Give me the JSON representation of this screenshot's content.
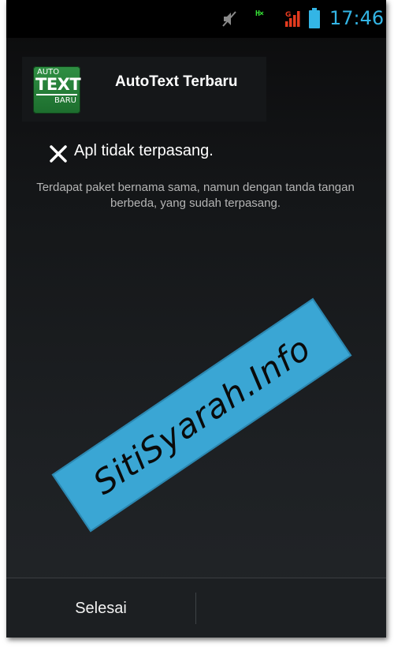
{
  "status_bar": {
    "time": "17:46",
    "network_label": "H×",
    "signal_label": "G",
    "colors": {
      "clock": "#33b5e5",
      "network": "#35e035",
      "signal": "#e33b1f"
    }
  },
  "app": {
    "name": "AutoText Terbaru",
    "icon_text": {
      "line1": "AUTO",
      "line2": "TEXT",
      "line3": "BARU"
    },
    "icon_color": "#2f8f43"
  },
  "message": {
    "title": "Apl tidak terpasang.",
    "description": "Terdapat paket bernama sama, namun dengan tanda tangan berbeda, yang sudah terpasang."
  },
  "watermark": {
    "text": "SitiSyarah.Info",
    "color": "#3aa6d4"
  },
  "actions": {
    "done_label": "Selesai"
  }
}
